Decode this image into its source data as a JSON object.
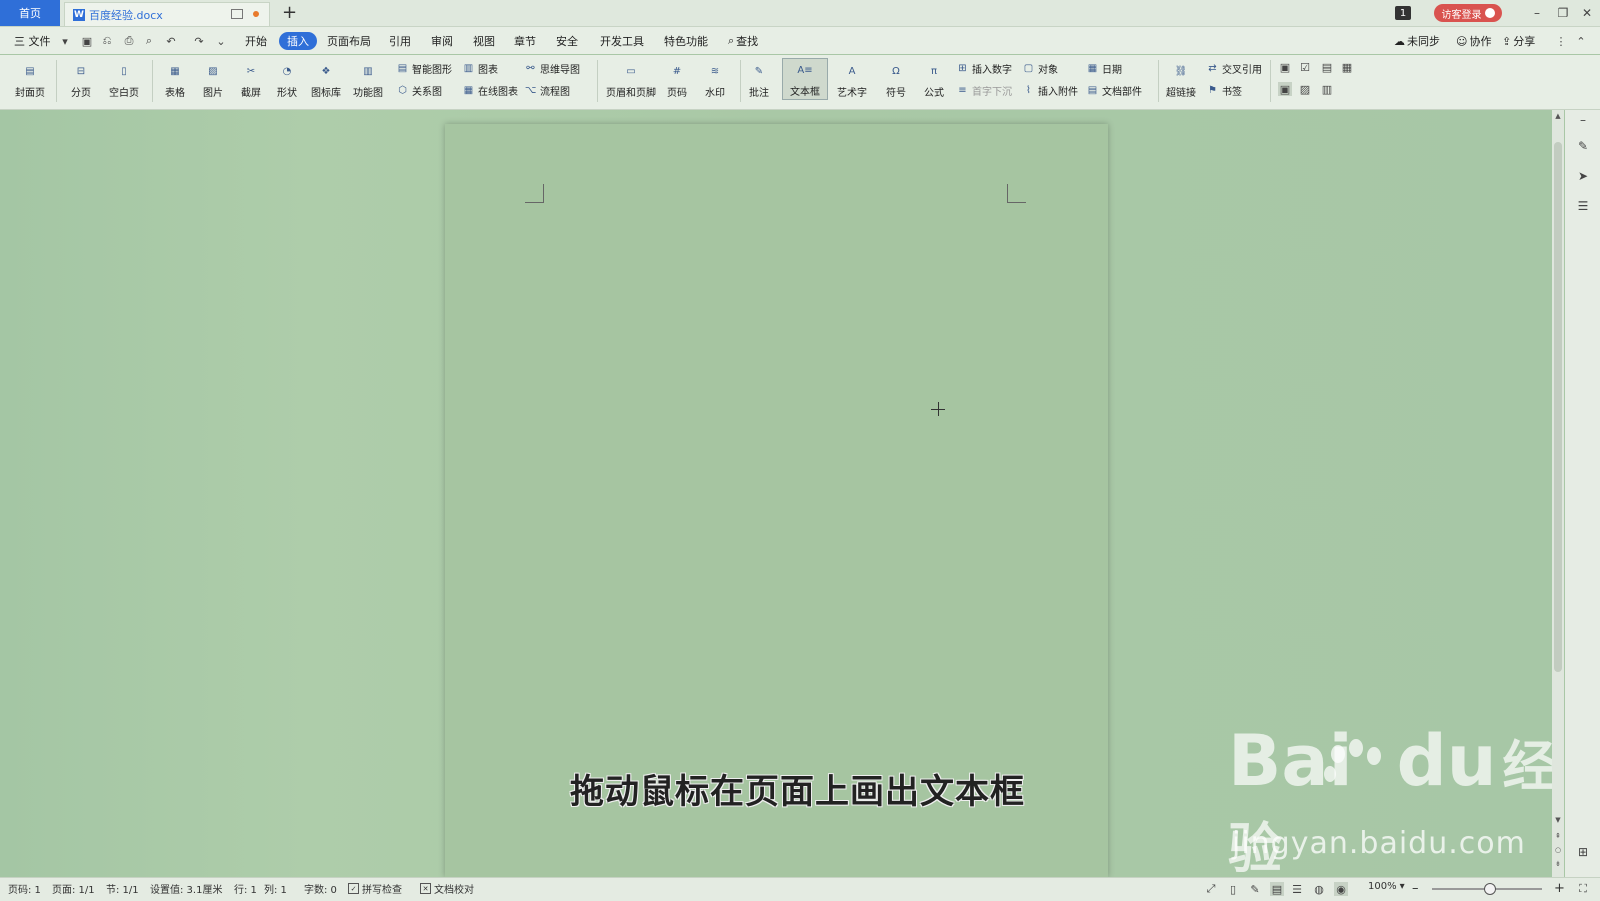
{
  "titlebar": {
    "home_tab": "首页",
    "doc_tab": "百度经验.docx",
    "doc_icon": "W",
    "new_tab": "+",
    "badge": "1",
    "guest_login": "访客登录",
    "minimize": "–",
    "restore": "❐",
    "close": "✕"
  },
  "menu": {
    "file": "三 文件",
    "items": [
      "开始",
      "插入",
      "页面布局",
      "引用",
      "审阅",
      "视图",
      "章节",
      "安全",
      "开发工具",
      "特色功能"
    ],
    "active": "插入",
    "search": "查找",
    "sync": "未同步",
    "collab": "协作",
    "share": "分享"
  },
  "ribbon": {
    "large": [
      "封面页",
      "分页",
      "空白页",
      "表格",
      "图片",
      "截屏",
      "形状",
      "图标库",
      "功能图",
      "页眉和页脚",
      "页码",
      "水印",
      "批注",
      "文本框",
      "艺术字",
      "符号",
      "公式",
      "超链接"
    ],
    "small": {
      "smart_shape": "智能图形",
      "chart": "图表",
      "mindmap": "思维导图",
      "relation": "关系图",
      "online_chart": "在线图表",
      "flowchart": "流程图",
      "insert_number": "插入数字",
      "object": "对象",
      "date": "日期",
      "dropcap": "首字下沉",
      "attachment": "插入附件",
      "doc_parts": "文档部件",
      "cross_ref": "交叉引用",
      "bookmark": "书签"
    }
  },
  "document": {
    "caption": "拖动鼠标在页面上画出文本框"
  },
  "watermark": {
    "brand": "Bai",
    "brand2": "du",
    "cn": "经验",
    "url": "jingyan.baidu.com"
  },
  "status": {
    "page_num": "页码: 1",
    "pages": "页面: 1/1",
    "section": "节: 1/1",
    "setting": "设置值: 3.1厘米",
    "row": "行: 1",
    "col": "列: 1",
    "words": "字数: 0",
    "spell": "拼写检查",
    "proof": "文档校对",
    "zoom": "100%",
    "zoom_minus": "–",
    "zoom_plus": "+"
  }
}
